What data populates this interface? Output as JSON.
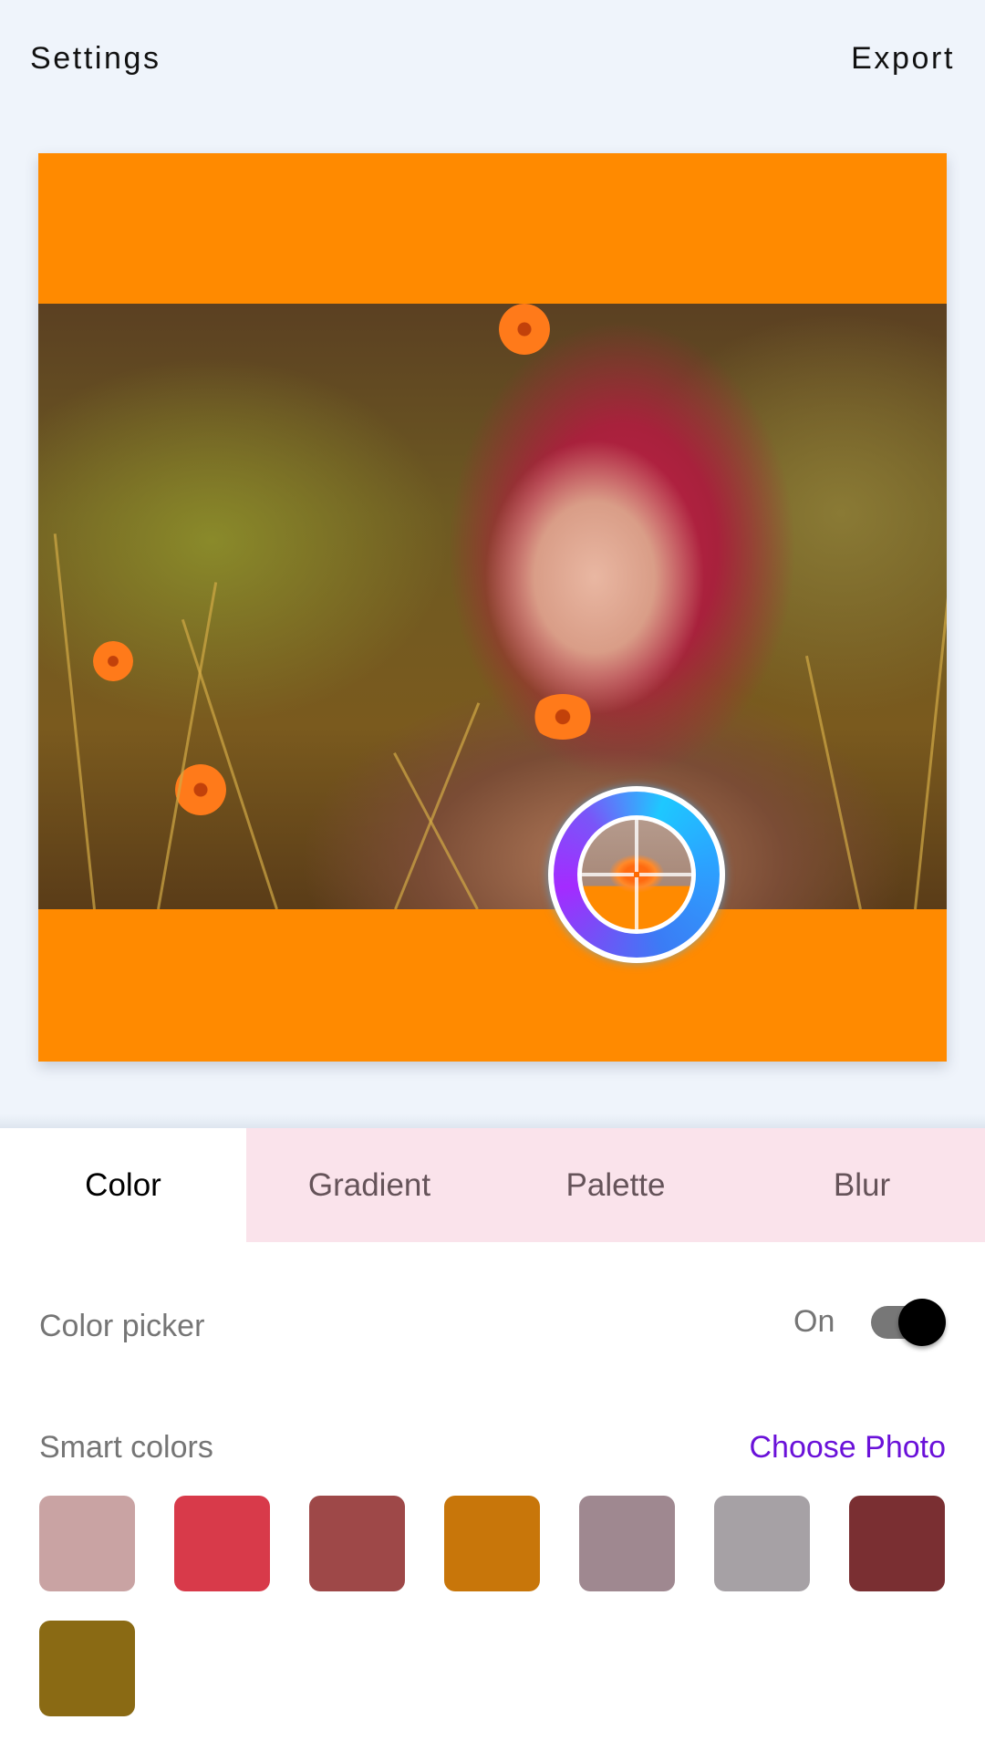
{
  "topbar": {
    "settings_label": "Settings",
    "export_label": "Export"
  },
  "canvas": {
    "background_color": "#ff8a00",
    "photo_description": "Woman with red hair lying in a field of grass and orange flowers, holding an orange flower"
  },
  "color_picker_overlay": {
    "icon": "crosshair-icon",
    "ring_gradient": [
      "#1ec8ff",
      "#3b7cf5",
      "#a42bff"
    ]
  },
  "tabs": [
    {
      "label": "Color",
      "active": true
    },
    {
      "label": "Gradient",
      "active": false
    },
    {
      "label": "Palette",
      "active": false
    },
    {
      "label": "Blur",
      "active": false
    }
  ],
  "color_picker_setting": {
    "label": "Color picker",
    "state_label": "On",
    "enabled": true
  },
  "smart_colors": {
    "label": "Smart colors",
    "choose_photo_label": "Choose Photo",
    "swatches": [
      "#c9a3a3",
      "#d83a4a",
      "#9e4848",
      "#c8760a",
      "#9f8890",
      "#a6a1a5",
      "#7a2f32",
      "#8a6a14"
    ]
  }
}
